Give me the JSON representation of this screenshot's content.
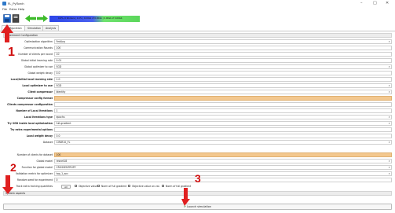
{
  "window": {
    "title": "FL_PyTorch",
    "controls": [
      "–",
      "□",
      "✕"
    ]
  },
  "menu": [
    "File",
    "Extra",
    "Help"
  ],
  "toolbar": {
    "status_text": "0.0%, 0 Workers | 0.0% | 0.00Gb of 0.00Gb | 0.00Gb of 0.00Gb"
  },
  "tabs": [
    "Configuration",
    "Simulation",
    "Analysis"
  ],
  "sections": {
    "experiment": "Experiment Configuration",
    "system": "System aspects"
  },
  "rows": [
    {
      "label": "Optimization algorithm",
      "value": "FedAvg",
      "dropdown": true,
      "bold": false,
      "orange": false
    },
    {
      "label": "Communication Rounds",
      "value": "100",
      "dropdown": false,
      "bold": false,
      "orange": false
    },
    {
      "label": "Number of clients per round",
      "value": "10",
      "dropdown": false,
      "bold": false,
      "orange": false
    },
    {
      "label": "Global initial learning rate",
      "value": "0.01",
      "dropdown": false,
      "bold": false,
      "orange": false
    },
    {
      "label": "Global optimizer to use",
      "value": "SGD",
      "dropdown": true,
      "bold": false,
      "orange": false
    },
    {
      "label": "Global weight decay",
      "value": "0.0",
      "dropdown": false,
      "bold": false,
      "orange": false
    },
    {
      "label": "Local/Initial local learning rate",
      "value": "1.0",
      "dropdown": false,
      "bold": true,
      "orange": false
    },
    {
      "label": "Local optimizer to use",
      "value": "SGD",
      "dropdown": true,
      "bold": true,
      "orange": false
    },
    {
      "label": "Client compressor",
      "value": "Identity",
      "dropdown": true,
      "bold": true,
      "orange": false
    },
    {
      "label": "Compressor config format",
      "value": "",
      "dropdown": false,
      "bold": true,
      "orange": true
    },
    {
      "label": "Clients compressor configuration",
      "value": "",
      "dropdown": false,
      "bold": true,
      "orange": false
    },
    {
      "label": "Number of Local Iterations",
      "value": "1",
      "dropdown": false,
      "bold": true,
      "orange": false
    },
    {
      "label": "Local Iterations type",
      "value": "epochs",
      "dropdown": true,
      "bold": true,
      "orange": false
    },
    {
      "label": "Try SGD inside local optimization",
      "value": "full-gradient",
      "dropdown": true,
      "bold": true,
      "orange": false
    },
    {
      "label": "Try extra experimental options",
      "value": "",
      "dropdown": false,
      "bold": true,
      "orange": false
    },
    {
      "label": "Local weight decay",
      "value": "0.0",
      "dropdown": false,
      "bold": true,
      "orange": false
    },
    {
      "label": "Dataset",
      "value": "CIFAR10_FL",
      "dropdown": true,
      "bold": false,
      "orange": false
    },
    {
      "label": "",
      "value": "",
      "dropdown": false,
      "bold": false,
      "orange": false
    },
    {
      "label": "Number of clients for dataset",
      "value": "100",
      "dropdown": false,
      "bold": false,
      "orange": true
    },
    {
      "label": "Global model",
      "value": "resnet18",
      "dropdown": true,
      "bold": false,
      "orange": false
    },
    {
      "label": "Function for global model",
      "value": "CROSSENTROPY",
      "dropdown": true,
      "bold": false,
      "orange": false
    },
    {
      "label": "Validation metric for optimizer",
      "value": "top_1_acc",
      "dropdown": true,
      "bold": false,
      "orange": false
    },
    {
      "label": "Random seed for experiment",
      "value": "0",
      "dropdown": false,
      "bold": false,
      "orange": false
    }
  ],
  "tracking": {
    "label": "Track extra training quantities",
    "button": "All",
    "checkboxes": [
      "Objective value",
      "Norm of full gradient",
      "Objective value on val.",
      "Norm of full gradient"
    ]
  },
  "launch": {
    "label": "Launch simulation"
  },
  "annotations": [
    "1",
    "2",
    "3"
  ],
  "colors": {
    "annotation": "#e02020",
    "orange_field": "#f3c88f",
    "green_arrow": "#3dbb2a",
    "save_icon": "#1f66c4"
  }
}
